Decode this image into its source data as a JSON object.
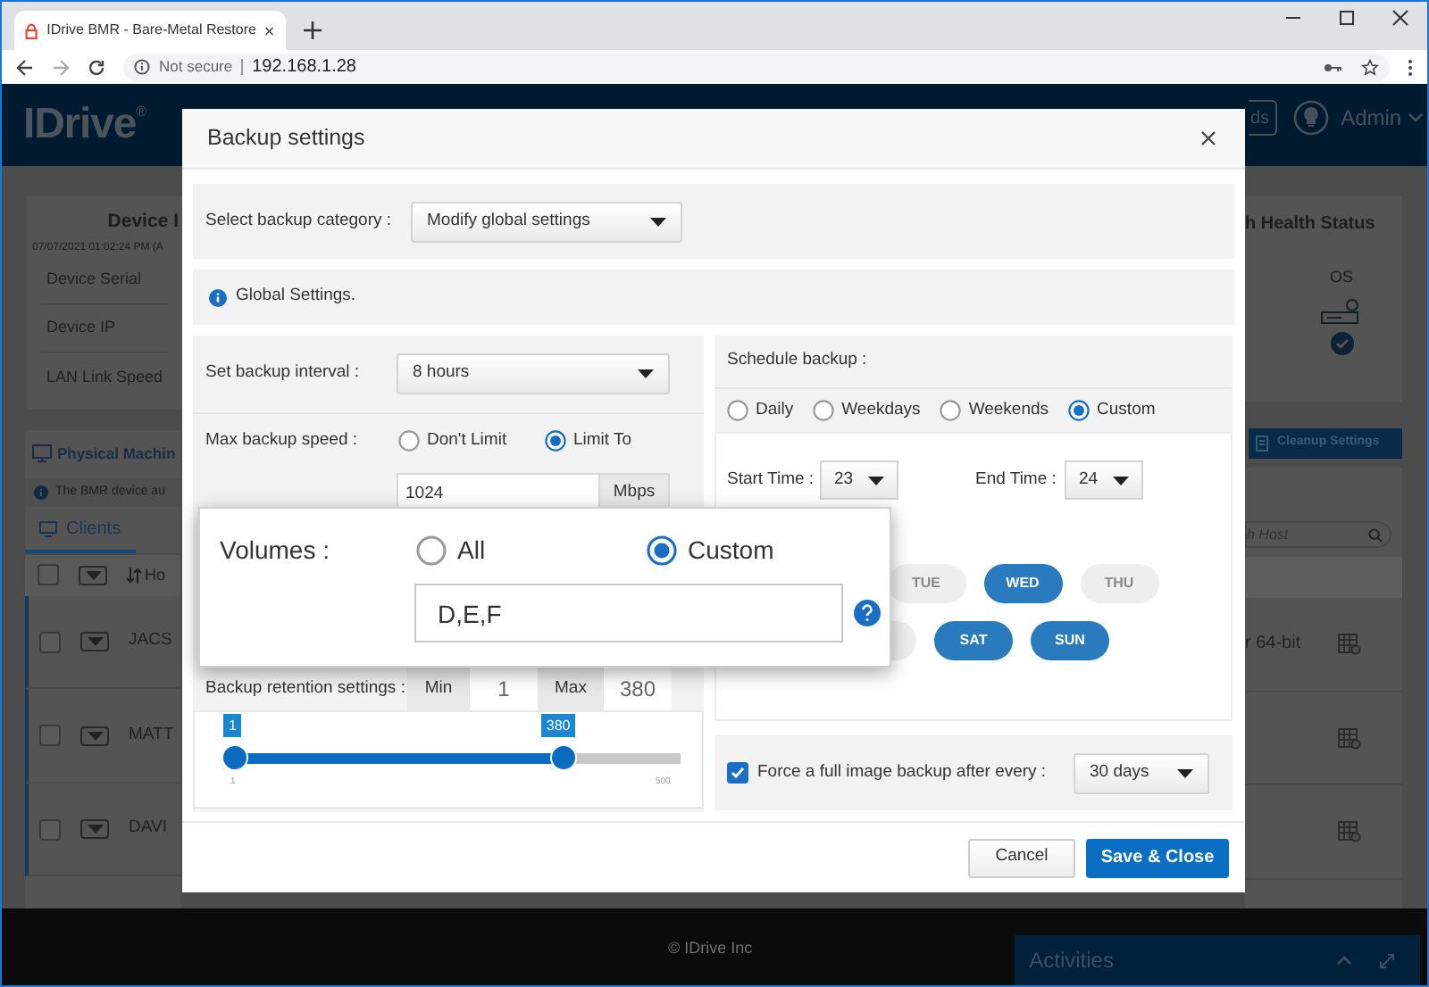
{
  "browser": {
    "tab_title": "IDrive BMR - Bare-Metal Restore",
    "security": "Not secure",
    "url": "192.168.1.28"
  },
  "app_header": {
    "logo": "IDrive",
    "logo_mark": "®",
    "button": "ds",
    "user": "Admin"
  },
  "device_card": {
    "title": "Device I",
    "timestamp": "07/07/2021 01:02:24 PM (A",
    "rows": [
      "Device Serial",
      "Device IP",
      "LAN Link Speed"
    ]
  },
  "health_card": {
    "title": "h Health Status",
    "column": "OS"
  },
  "machines": {
    "title": "Physical Machin",
    "notice": "The BMR device au",
    "tab": "Clients",
    "column": "Ho",
    "header_checked": false,
    "cleanup_button": "Cleanup Settings",
    "search": {
      "placeholder": "h Host"
    },
    "rows": [
      {
        "name": "JACS",
        "os": "r 64-bit",
        "checked": false
      },
      {
        "name": "MATT",
        "checked": false
      },
      {
        "name": "DAVI",
        "checked": false
      }
    ]
  },
  "footer": {
    "copyright": "© IDrive Inc",
    "activities": "Activities"
  },
  "modal": {
    "title": "Backup settings",
    "category": {
      "label": "Select backup category :",
      "value": "Modify global settings"
    },
    "info": "Global Settings.",
    "interval": {
      "label": "Set backup interval :",
      "value": "8 hours"
    },
    "speed": {
      "label": "Max backup speed :",
      "options": [
        {
          "label": "Don't Limit",
          "selected": false
        },
        {
          "label": "Limit To",
          "selected": true
        }
      ],
      "value": "1024",
      "unit": "Mbps"
    },
    "retention": {
      "label": "Backup retention settings :",
      "min_label": "Min",
      "min": "1",
      "max_label": "Max",
      "max": "380"
    },
    "slider": {
      "low": {
        "label": "1",
        "level": 0
      },
      "high": {
        "label": "380",
        "level": 0.76
      },
      "scale_min": "1",
      "scale_max": "500"
    },
    "schedule": {
      "title": "Schedule backup :",
      "options": [
        {
          "label": "Daily",
          "selected": false
        },
        {
          "label": "Weekdays",
          "selected": false
        },
        {
          "label": "Weekends",
          "selected": false
        },
        {
          "label": "Custom",
          "selected": true
        }
      ],
      "start_label": "Start Time :",
      "start": "23",
      "end_label": "End Time :",
      "end": "24",
      "days": [
        {
          "label": "TUE",
          "selected": false
        },
        {
          "label": "WED",
          "selected": true
        },
        {
          "label": "THU",
          "selected": false
        },
        {
          "selected": false
        },
        {
          "label": "SAT",
          "selected": true
        },
        {
          "label": "SUN",
          "selected": true
        }
      ]
    },
    "force": {
      "label": "Force a full image backup after every :",
      "checked": true,
      "value": "30 days"
    },
    "buttons": [
      {
        "label": "Cancel",
        "kind": "secondary"
      },
      {
        "label": "Save & Close",
        "kind": "primary"
      }
    ]
  },
  "volumes_callout": {
    "label": "Volumes :",
    "options": [
      {
        "label": "All",
        "selected": false
      },
      {
        "label": "Custom",
        "selected": true
      }
    ],
    "value": "D,E,F"
  }
}
